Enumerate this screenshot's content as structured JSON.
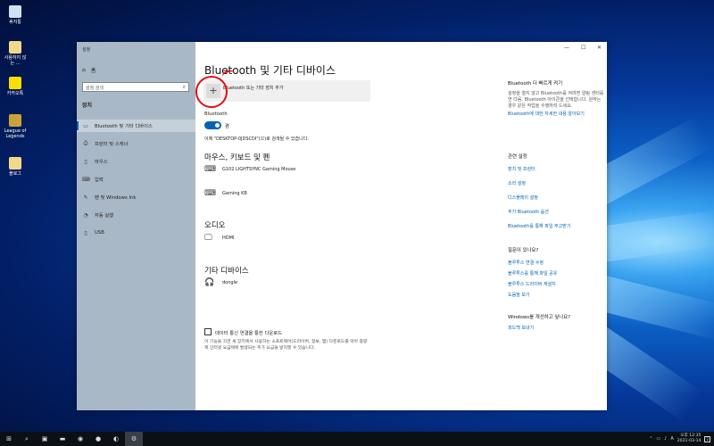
{
  "desktop": {
    "icons": [
      {
        "label": "휴지통",
        "icon": "recycle-bin-icon",
        "color": "#cfe3f5"
      },
      {
        "label": "사용하지 않는 …",
        "icon": "file-icon",
        "color": "#f2d98a"
      },
      {
        "label": "카카오톡",
        "icon": "kakaotalk-icon",
        "color": "#f9e000"
      },
      {
        "label": "League of Legends",
        "icon": "lol-icon",
        "color": "#c9a33a"
      },
      {
        "label": "블로그",
        "icon": "file-icon",
        "color": "#f2d98a"
      }
    ]
  },
  "window": {
    "title": "설정",
    "controls": {
      "minimize": "—",
      "maximize": "☐",
      "close": "✕"
    }
  },
  "sidebar": {
    "home": "홈",
    "search_placeholder": "설정 검색",
    "section": "장치",
    "items": [
      {
        "label": "Bluetooth 및 기타 디바이스",
        "icon": "bluetooth-devices-icon",
        "glyph": "▭"
      },
      {
        "label": "프린터 및 스캐너",
        "icon": "printer-icon",
        "glyph": "⎙"
      },
      {
        "label": "마우스",
        "icon": "mouse-icon",
        "glyph": "▯"
      },
      {
        "label": "입력",
        "icon": "keyboard-icon",
        "glyph": "⌨"
      },
      {
        "label": "펜 및 Windows Ink",
        "icon": "pen-icon",
        "glyph": "✎"
      },
      {
        "label": "자동 실행",
        "icon": "autoplay-icon",
        "glyph": "◔"
      },
      {
        "label": "USB",
        "icon": "usb-icon",
        "glyph": "▯"
      }
    ]
  },
  "main": {
    "title": "Bluetooth 및 기타 디바이스",
    "add_device": "Bluetooth 또는 기타 장치 추가",
    "bluetooth_label": "Bluetooth",
    "bluetooth_state": "켬",
    "discoverable": "이제 \"DESKTOP-0JDSCDI\"(으)로 검색될 수 있습니다.",
    "groups": [
      {
        "heading": "마우스, 키보드 및 펜",
        "devices": [
          {
            "name": "G102 LIGHTSYNC Gaming Mouse",
            "icon": "keyboard-icon",
            "glyph": "⌨"
          },
          {
            "name": "Gaming KB",
            "icon": "keyboard-icon",
            "glyph": "⌨"
          }
        ]
      },
      {
        "heading": "오디오",
        "devices": [
          {
            "name": "HDMI",
            "icon": "monitor-icon",
            "glyph": "🖵"
          }
        ]
      },
      {
        "heading": "기타 디바이스",
        "devices": [
          {
            "name": "dongle",
            "icon": "headset-icon",
            "glyph": "🎧"
          }
        ]
      }
    ],
    "metered": {
      "label": "데이터 통신 연결을 통한 다운로드",
      "checked": false,
      "description": "이 기능을 끄면 새 장치에서 사용하는 소프트웨어(드라이버, 정보, 앱) 다운로드를 막아 종량제 인터넷 요금제에 발생되는 추가 요금을 방지할 수 있습니다."
    }
  },
  "right_panel": {
    "quick": {
      "heading": "Bluetooth 더 빠르게 켜기",
      "body": "설정을 열지 않고 Bluetooth를 켜려면 알림 센터를 연 다음, Bluetooth 아이콘을 선택합니다. 원하는 경우 같은 작업을 수행하려 드세요.",
      "link": "Bluetooth에 대한 자세한 내용 알아보기"
    },
    "related": {
      "heading": "관련 설정",
      "links": [
        "장치 및 프린터",
        "소리 설정",
        "디스플레이 설정",
        "추가 Bluetooth 옵션",
        "Bluetooth를 통해 파일 주고받기"
      ]
    },
    "help": {
      "heading": "질문이 있나요?",
      "links": [
        "블루투스 연결 수정",
        "블루투스를 통해 파일 공유",
        "블루투스 드라이버 재설치",
        "도움말 보기"
      ]
    },
    "feedback": {
      "heading": "Windows를 개선하고 싶나요?",
      "link": "피드백 보내기"
    }
  },
  "taskbar": {
    "start": "⊞",
    "apps": [
      {
        "glyph": "⌕",
        "icon": "search-icon"
      },
      {
        "glyph": "▣",
        "icon": "task-view-icon"
      },
      {
        "glyph": "▬",
        "icon": "file-explorer-icon"
      },
      {
        "glyph": "◉",
        "icon": "edge-icon"
      },
      {
        "glyph": "●",
        "icon": "chrome-icon"
      },
      {
        "glyph": "◐",
        "icon": "app-icon"
      },
      {
        "glyph": "⚙",
        "icon": "settings-gear-icon"
      }
    ],
    "tray": {
      "ime": "A",
      "time": "오후 12:35",
      "date": "2021-03-14",
      "notif_count": "2"
    }
  }
}
